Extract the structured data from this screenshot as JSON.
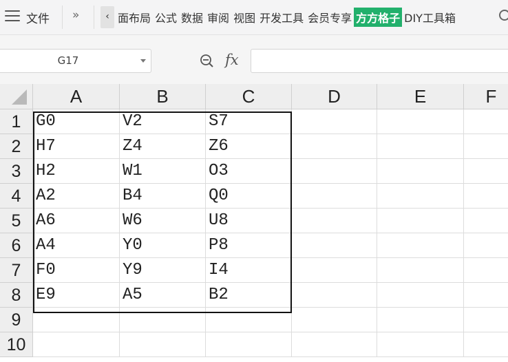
{
  "menu": {
    "file_label": "文件",
    "more_icon": "»",
    "scroll_left_icon": "‹",
    "tabs": [
      {
        "label": "面布局",
        "highlight": false
      },
      {
        "label": "公式",
        "highlight": false
      },
      {
        "label": "数据",
        "highlight": false
      },
      {
        "label": "审阅",
        "highlight": false
      },
      {
        "label": "视图",
        "highlight": false
      },
      {
        "label": "开发工具",
        "highlight": false
      },
      {
        "label": "会员专享",
        "highlight": false
      },
      {
        "label": "方方格子",
        "highlight": true
      },
      {
        "label": "DIY工具箱",
        "highlight": false
      }
    ],
    "highlight_color": "#22b06c"
  },
  "formula_bar": {
    "cell_ref": "G17",
    "fx_label": "fx",
    "formula_value": ""
  },
  "sheet": {
    "columns": [
      "A",
      "B",
      "C",
      "D",
      "E",
      "F"
    ],
    "rows": [
      "1",
      "2",
      "3",
      "4",
      "5",
      "6",
      "7",
      "8",
      "9",
      "10"
    ],
    "cells": [
      [
        "G0",
        "V2",
        "S7"
      ],
      [
        "H7",
        "Z4",
        "Z6"
      ],
      [
        "H2",
        "W1",
        "O3"
      ],
      [
        "A2",
        "B4",
        "Q0"
      ],
      [
        "A6",
        "W6",
        "U8"
      ],
      [
        "A4",
        "Y0",
        "P8"
      ],
      [
        "F0",
        "Y9",
        "I4"
      ],
      [
        "E9",
        "A5",
        "B2"
      ]
    ]
  }
}
